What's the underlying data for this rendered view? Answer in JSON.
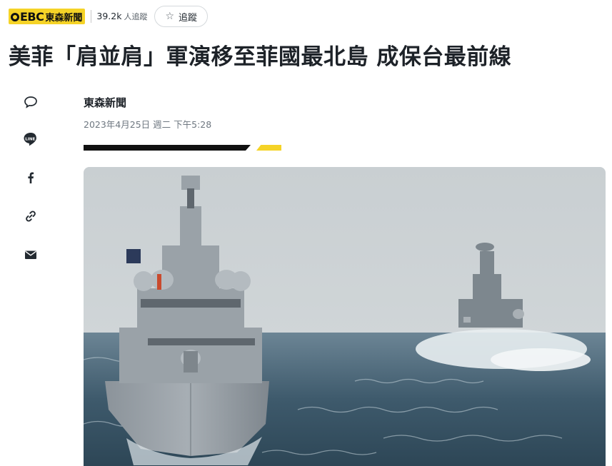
{
  "publisher": {
    "logo_mark": "EBC",
    "logo_name": "東森新聞",
    "followers_count": "39.2k",
    "followers_suffix": "人追蹤",
    "follow_label": "追蹤"
  },
  "article": {
    "headline": "美菲「肩並肩」軍演移至菲國最北島 成保台最前線",
    "author": "東森新聞",
    "date": "2023年4月25日 週二 下午5:28"
  },
  "share_buttons": [
    {
      "icon": "comment-icon"
    },
    {
      "icon": "line-icon",
      "label": "LINE"
    },
    {
      "icon": "facebook-icon",
      "label": "f"
    },
    {
      "icon": "link-icon"
    },
    {
      "icon": "email-icon"
    }
  ],
  "colors": {
    "brand_yellow": "#f5d327",
    "text": "#1d2228",
    "muted": "#6e7780"
  }
}
